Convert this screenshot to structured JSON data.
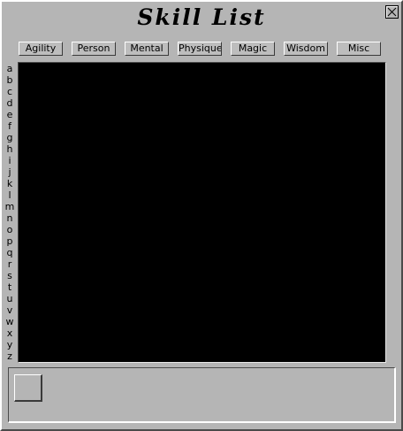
{
  "window": {
    "title": "Skill List",
    "close_icon": "close-x-icon"
  },
  "tabs": [
    {
      "label": "Agility"
    },
    {
      "label": "Person"
    },
    {
      "label": "Mental"
    },
    {
      "label": "Physique"
    },
    {
      "label": "Magic"
    },
    {
      "label": "Wisdom"
    },
    {
      "label": "Misc"
    }
  ],
  "alphabet": [
    "a",
    "b",
    "c",
    "d",
    "e",
    "f",
    "g",
    "h",
    "i",
    "j",
    "k",
    "l",
    "m",
    "n",
    "o",
    "p",
    "q",
    "r",
    "s",
    "t",
    "u",
    "v",
    "w",
    "x",
    "y",
    "z"
  ],
  "skill_list": {
    "items": []
  },
  "colors": {
    "panel": "#b5b5b5",
    "list_background": "#000000"
  }
}
